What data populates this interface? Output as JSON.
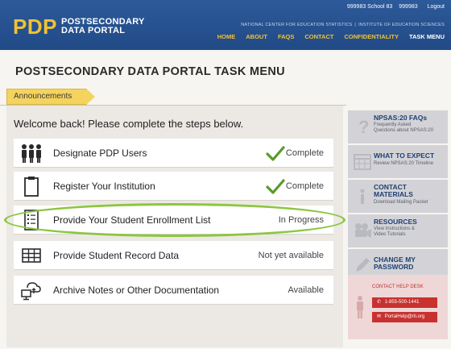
{
  "header": {
    "logo_mark": "PDP",
    "logo_line1": "POSTSECONDARY",
    "logo_line2": "DATA PORTAL",
    "util": [
      "999983 School 83",
      "999983",
      "Logout"
    ],
    "agency_left": "NATIONAL CENTER FOR EDUCATION STATISTICS",
    "agency_sep": "|",
    "agency_right": "INSTITUTE OF EDUCATION SCIENCES",
    "nav": [
      "HOME",
      "ABOUT",
      "FAQS",
      "CONTACT",
      "CONFIDENTIALITY",
      "TASK MENU"
    ]
  },
  "page_title": "POSTSECONDARY DATA PORTAL TASK MENU",
  "announcements_label": "Announcements",
  "welcome": "Welcome back! Please complete the steps below.",
  "steps": [
    {
      "label": "Designate PDP Users",
      "status": "Complete",
      "icon": "users-icon"
    },
    {
      "label": "Register Your Institution",
      "status": "Complete",
      "icon": "clipboard-icon"
    },
    {
      "label": "Provide Your Student Enrollment List",
      "status": "In Progress",
      "icon": "list-icon"
    },
    {
      "label": "Provide Student Record Data",
      "status": "Not yet available",
      "icon": "table-icon"
    },
    {
      "label": "Archive Notes or Other Documentation",
      "status": "Available",
      "icon": "cloud-computer-icon"
    }
  ],
  "sidebar": {
    "faq": {
      "title": "NPSAS:20 FAQs",
      "sub1": "Frequently Asked",
      "sub2": "Questions about NPSAS:20"
    },
    "expect": {
      "title": "WHAT TO EXPECT",
      "sub1": "Review NPSAS:20 Timeline"
    },
    "contact": {
      "title1": "CONTACT",
      "title2": "MATERIALS",
      "sub1": "Download Mailing Packet"
    },
    "resources": {
      "title": "RESOURCES",
      "sub1": "View Instructions &",
      "sub2": "Video Tutorials"
    },
    "password": {
      "title1": "CHANGE MY",
      "title2": "PASSWORD"
    },
    "help": {
      "title": "CONTACT HELP DESK",
      "phone": "1-855-500-1441",
      "email": "PortalHelp@rti.org"
    }
  },
  "colors": {
    "header_blue": "#2d5a9a",
    "brand_yellow": "#f2c231",
    "check_green": "#5a9a2a",
    "highlight_green": "#8cc640",
    "help_red": "#c8312f"
  }
}
